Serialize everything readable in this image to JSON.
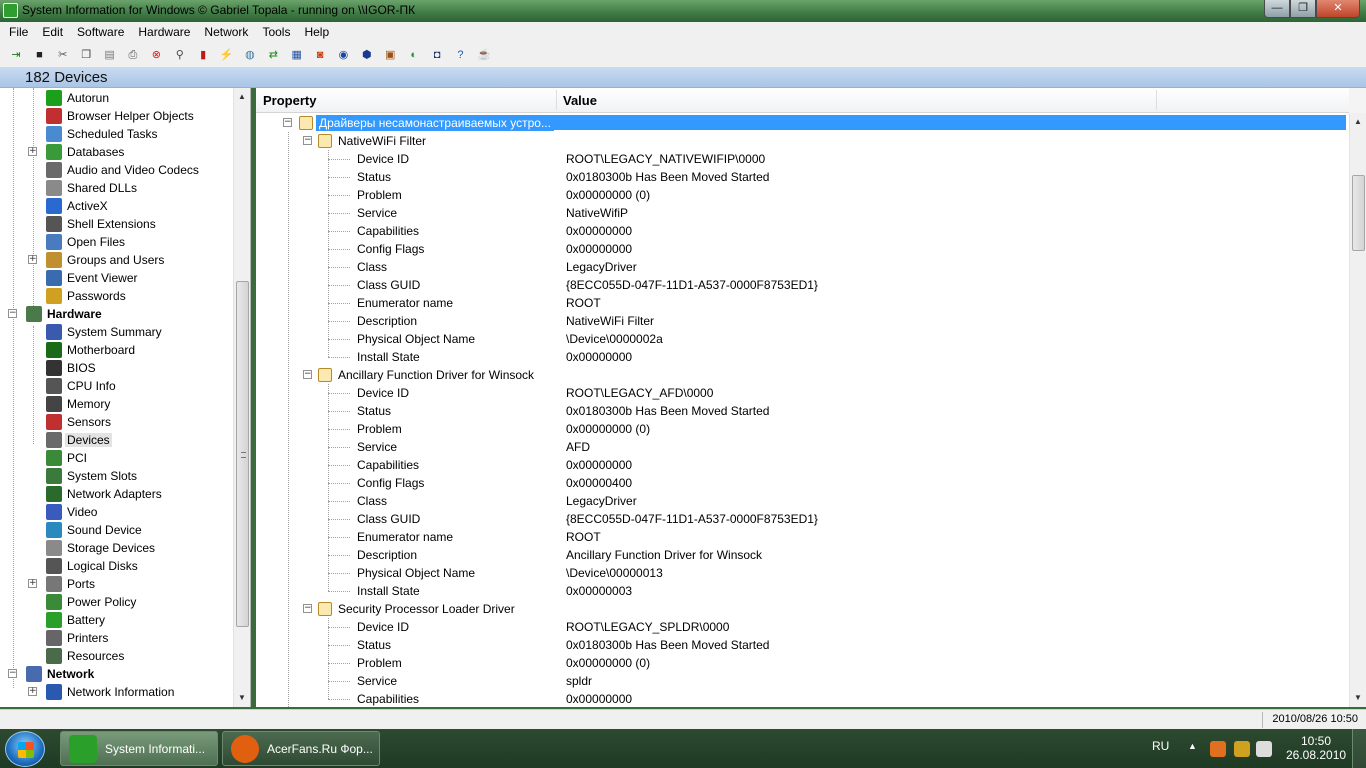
{
  "window": {
    "title": "System Information for Windows  © Gabriel Topala - running on \\\\IGOR-ПК",
    "min_glyph": "—",
    "max_glyph": "❐",
    "close_glyph": "✕"
  },
  "menu": [
    "File",
    "Edit",
    "Software",
    "Hardware",
    "Network",
    "Tools",
    "Help"
  ],
  "toolbar": {
    "icons": [
      {
        "name": "exit-icon",
        "glyph": "⇥",
        "color": "#1a7a1a"
      },
      {
        "name": "save-icon",
        "glyph": "■",
        "color": "#222222"
      },
      {
        "name": "cut-icon",
        "glyph": "✂",
        "color": "#555555"
      },
      {
        "name": "copy-icon",
        "glyph": "❐",
        "color": "#444444"
      },
      {
        "name": "copy-all-icon",
        "glyph": "▤",
        "color": "#777777"
      },
      {
        "name": "print-icon",
        "glyph": "⎙",
        "color": "#555555"
      },
      {
        "name": "stop-icon",
        "glyph": "⊗",
        "color": "#d02020"
      },
      {
        "name": "find-icon",
        "glyph": "⚲",
        "color": "#444444"
      },
      {
        "name": "monitor-icon",
        "glyph": "▮",
        "color": "#c01818"
      },
      {
        "name": "graph-icon",
        "glyph": "⚡",
        "color": "#1a5aa0"
      },
      {
        "name": "globe-icon",
        "glyph": "◍",
        "color": "#3a7a9a"
      },
      {
        "name": "refresh-icon",
        "glyph": "⇄",
        "color": "#1a8a1a"
      },
      {
        "name": "report-icon",
        "glyph": "▦",
        "color": "#2050a0"
      },
      {
        "name": "tools-icon",
        "glyph": "◙",
        "color": "#d04010"
      },
      {
        "name": "network-icon",
        "glyph": "◉",
        "color": "#1a4aa0"
      },
      {
        "name": "shield-icon",
        "glyph": "⬢",
        "color": "#1a3a90"
      },
      {
        "name": "devices-icon",
        "glyph": "▣",
        "color": "#a05010"
      },
      {
        "name": "web-icon",
        "glyph": "◐",
        "color": "#2a8a4a"
      },
      {
        "name": "camera-icon",
        "glyph": "◘",
        "color": "#1a3a70"
      },
      {
        "name": "help-icon",
        "glyph": "?",
        "color": "#1a5ab0"
      },
      {
        "name": "coffee-icon",
        "glyph": "☕",
        "color": "#8a4a10"
      }
    ]
  },
  "header": {
    "device_count": "182 Devices"
  },
  "tree": {
    "expander_plus": "+",
    "expander_minus": "−",
    "items": [
      {
        "label": "Autorun",
        "icon": "autorun-icon",
        "color": "#1aa01a",
        "level": 2,
        "expander": ""
      },
      {
        "label": "Browser Helper Objects",
        "icon": "bho-icon",
        "color": "#c03030",
        "level": 2,
        "expander": ""
      },
      {
        "label": "Scheduled Tasks",
        "icon": "tasks-icon",
        "color": "#4a8ad0",
        "level": 2,
        "expander": ""
      },
      {
        "label": "Databases",
        "icon": "databases-icon",
        "color": "#3a9a3a",
        "level": 2,
        "expander": "plus"
      },
      {
        "label": "Audio and Video Codecs",
        "icon": "codecs-icon",
        "color": "#6a6a6a",
        "level": 2,
        "expander": ""
      },
      {
        "label": "Shared DLLs",
        "icon": "dll-icon",
        "color": "#8a8a8a",
        "level": 2,
        "expander": ""
      },
      {
        "label": "ActiveX",
        "icon": "activex-icon",
        "color": "#2a6ad0",
        "level": 2,
        "expander": ""
      },
      {
        "label": "Shell Extensions",
        "icon": "shell-icon",
        "color": "#555555",
        "level": 2,
        "expander": ""
      },
      {
        "label": "Open Files",
        "icon": "files-icon",
        "color": "#4a7ac0",
        "level": 2,
        "expander": ""
      },
      {
        "label": "Groups and Users",
        "icon": "users-icon",
        "color": "#c09030",
        "level": 2,
        "expander": "plus"
      },
      {
        "label": "Event Viewer",
        "icon": "events-icon",
        "color": "#3a6ab0",
        "level": 2,
        "expander": ""
      },
      {
        "label": "Passwords",
        "icon": "key-icon",
        "color": "#d0a020",
        "level": 2,
        "expander": ""
      },
      {
        "label": "Hardware",
        "icon": "hardware-icon",
        "color": "#4a7a4a",
        "level": 1,
        "expander": "minus",
        "bold": true
      },
      {
        "label": "System Summary",
        "icon": "summary-icon",
        "color": "#3a5ab0",
        "level": 2,
        "expander": ""
      },
      {
        "label": "Motherboard",
        "icon": "motherboard-icon",
        "color": "#1a6a1a",
        "level": 2,
        "expander": ""
      },
      {
        "label": "BIOS",
        "icon": "bios-icon",
        "color": "#333333",
        "level": 2,
        "expander": ""
      },
      {
        "label": "CPU Info",
        "icon": "cpu-icon",
        "color": "#555555",
        "level": 2,
        "expander": ""
      },
      {
        "label": "Memory",
        "icon": "memory-icon",
        "color": "#444444",
        "level": 2,
        "expander": ""
      },
      {
        "label": "Sensors",
        "icon": "sensors-icon",
        "color": "#c03030",
        "level": 2,
        "expander": ""
      },
      {
        "label": "Devices",
        "icon": "devices-icon",
        "color": "#6a6a6a",
        "level": 2,
        "expander": "",
        "selected": true
      },
      {
        "label": "PCI",
        "icon": "pci-icon",
        "color": "#3a8a3a",
        "level": 2,
        "expander": ""
      },
      {
        "label": "System Slots",
        "icon": "slots-icon",
        "color": "#3a7a3a",
        "level": 2,
        "expander": ""
      },
      {
        "label": "Network Adapters",
        "icon": "adapter-icon",
        "color": "#2a6a2a",
        "level": 2,
        "expander": ""
      },
      {
        "label": "Video",
        "icon": "video-icon",
        "color": "#3a5ac0",
        "level": 2,
        "expander": ""
      },
      {
        "label": "Sound Device",
        "icon": "sound-icon",
        "color": "#2a8ac0",
        "level": 2,
        "expander": ""
      },
      {
        "label": "Storage Devices",
        "icon": "storage-icon",
        "color": "#8a8a8a",
        "level": 2,
        "expander": ""
      },
      {
        "label": "Logical Disks",
        "icon": "disk-icon",
        "color": "#555555",
        "level": 2,
        "expander": ""
      },
      {
        "label": "Ports",
        "icon": "ports-icon",
        "color": "#777777",
        "level": 2,
        "expander": "plus"
      },
      {
        "label": "Power Policy",
        "icon": "power-icon",
        "color": "#3a8a3a",
        "level": 2,
        "expander": ""
      },
      {
        "label": "Battery",
        "icon": "battery-icon",
        "color": "#2aa02a",
        "level": 2,
        "expander": ""
      },
      {
        "label": "Printers",
        "icon": "printer-icon",
        "color": "#666666",
        "level": 2,
        "expander": ""
      },
      {
        "label": "Resources",
        "icon": "resources-icon",
        "color": "#4a6a4a",
        "level": 2,
        "expander": ""
      },
      {
        "label": "Network",
        "icon": "network-icon",
        "color": "#4a6ab0",
        "level": 1,
        "expander": "minus",
        "bold": true
      },
      {
        "label": "Network Information",
        "icon": "info-icon",
        "color": "#2a5ab0",
        "level": 2,
        "expander": "plus"
      }
    ]
  },
  "columns": {
    "property": "Property",
    "value": "Value"
  },
  "properties": {
    "root_group": "Драйверы несамонастраиваемых устро...",
    "groups": [
      {
        "name": "NativeWiFi Filter",
        "rows": [
          {
            "p": "Device ID",
            "v": "ROOT\\LEGACY_NATIVEWIFIP\\0000"
          },
          {
            "p": "Status",
            "v": "0x0180300b Has Been Moved Started"
          },
          {
            "p": "Problem",
            "v": "0x00000000 (0)"
          },
          {
            "p": "Service",
            "v": "NativeWifiP"
          },
          {
            "p": "Capabilities",
            "v": "0x00000000"
          },
          {
            "p": "Config Flags",
            "v": "0x00000000"
          },
          {
            "p": "Class",
            "v": "LegacyDriver"
          },
          {
            "p": "Class GUID",
            "v": "{8ECC055D-047F-11D1-A537-0000F8753ED1}"
          },
          {
            "p": "Enumerator name",
            "v": "ROOT"
          },
          {
            "p": "Description",
            "v": "NativeWiFi Filter"
          },
          {
            "p": "Physical Object Name",
            "v": "\\Device\\0000002a"
          },
          {
            "p": "Install State",
            "v": "0x00000000"
          }
        ]
      },
      {
        "name": "Ancillary Function Driver for Winsock",
        "rows": [
          {
            "p": "Device ID",
            "v": "ROOT\\LEGACY_AFD\\0000"
          },
          {
            "p": "Status",
            "v": "0x0180300b Has Been Moved Started"
          },
          {
            "p": "Problem",
            "v": "0x00000000 (0)"
          },
          {
            "p": "Service",
            "v": "AFD"
          },
          {
            "p": "Capabilities",
            "v": "0x00000000"
          },
          {
            "p": "Config Flags",
            "v": "0x00000400"
          },
          {
            "p": "Class",
            "v": "LegacyDriver"
          },
          {
            "p": "Class GUID",
            "v": "{8ECC055D-047F-11D1-A537-0000F8753ED1}"
          },
          {
            "p": "Enumerator name",
            "v": "ROOT"
          },
          {
            "p": "Description",
            "v": "Ancillary Function Driver for Winsock"
          },
          {
            "p": "Physical Object Name",
            "v": "\\Device\\00000013"
          },
          {
            "p": "Install State",
            "v": "0x00000003"
          }
        ]
      },
      {
        "name": "Security Processor Loader Driver",
        "rows": [
          {
            "p": "Device ID",
            "v": "ROOT\\LEGACY_SPLDR\\0000"
          },
          {
            "p": "Status",
            "v": "0x0180300b Has Been Moved Started"
          },
          {
            "p": "Problem",
            "v": "0x00000000 (0)"
          },
          {
            "p": "Service",
            "v": "spldr"
          },
          {
            "p": "Capabilities",
            "v": "0x00000000"
          }
        ]
      }
    ]
  },
  "statusbar": {
    "datetime": "2010/08/26 10:50"
  },
  "taskbar": {
    "buttons": [
      {
        "label": "System Informati...",
        "icon": "sysinfo-icon",
        "color": "#2aa02a",
        "active": true
      },
      {
        "label": "AcerFans.Ru Фор...",
        "icon": "firefox-icon",
        "color": "#e06010",
        "active": false
      }
    ],
    "tray": {
      "lang": "RU",
      "time": "10:50",
      "date": "26.08.2010",
      "show_hidden_glyph": "▲",
      "icons": [
        {
          "name": "tray-app-icon",
          "color": "#e07020"
        },
        {
          "name": "tray-tool-icon",
          "color": "#d0a020"
        },
        {
          "name": "tray-network-icon",
          "color": "#dddddd"
        },
        {
          "name": "tray-volume-icon",
          "color": "#cccccc"
        }
      ]
    }
  }
}
